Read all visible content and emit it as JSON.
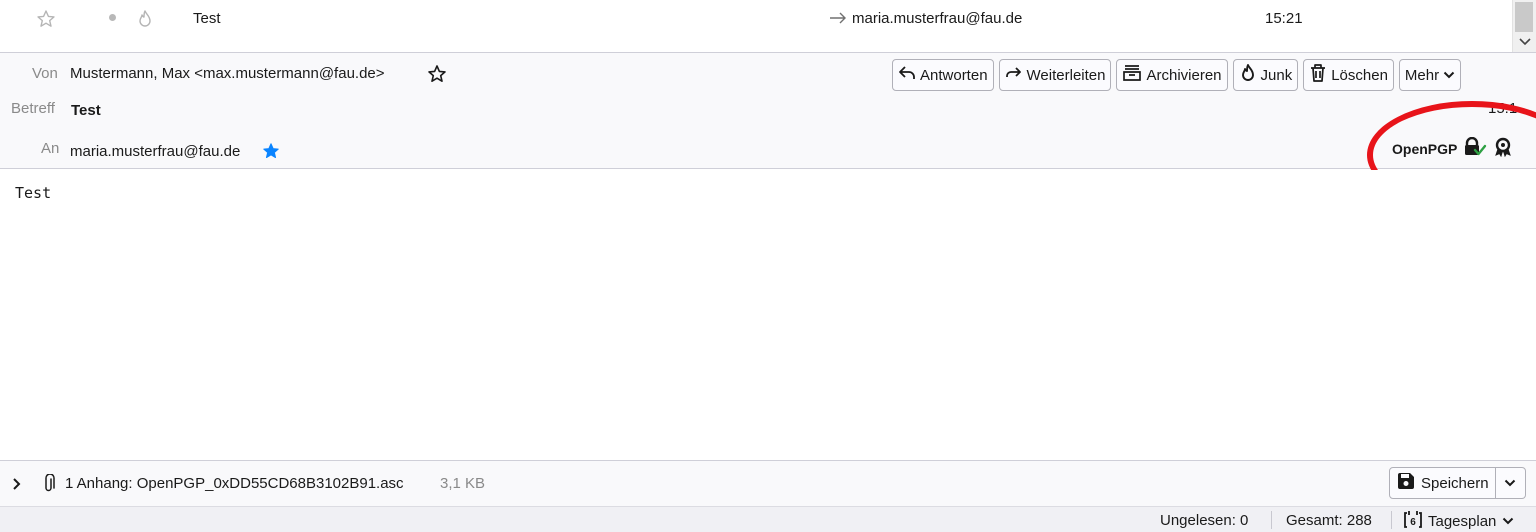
{
  "message_list": {
    "subject": "Test",
    "recipient": "maria.musterfrau@fau.de",
    "time": "15:21"
  },
  "header": {
    "from_label": "Von",
    "from_value": "Mustermann, Max <max.mustermann@fau.de>",
    "subject_label": "Betreff",
    "subject_value": "Test",
    "to_label": "An",
    "to_value": "maria.musterfrau@fau.de",
    "date_partial": "15:1",
    "toolbar": {
      "reply": "Antworten",
      "forward": "Weiterleiten",
      "archive": "Archivieren",
      "junk": "Junk",
      "delete": "Löschen",
      "more": "Mehr"
    },
    "security": {
      "label": "OpenPGP",
      "encryption_icon": "lock-check-icon",
      "signature_icon": "seal-icon",
      "highlight_color": "#e8141a"
    }
  },
  "body": {
    "text": "Test"
  },
  "attachments": {
    "summary": "1 Anhang: OpenPGP_0xDD55CD68B3102B91.asc",
    "size": "3,1 KB",
    "save_label": "Speichern"
  },
  "status_bar": {
    "unread": "Ungelesen: 0",
    "total": "Gesamt: 288",
    "today_pane": "Tagesplan",
    "today_day": "6"
  },
  "colors": {
    "accent_blue": "#0a84ff",
    "check_green": "#2ea043",
    "header_bg": "#f9f9fb"
  }
}
